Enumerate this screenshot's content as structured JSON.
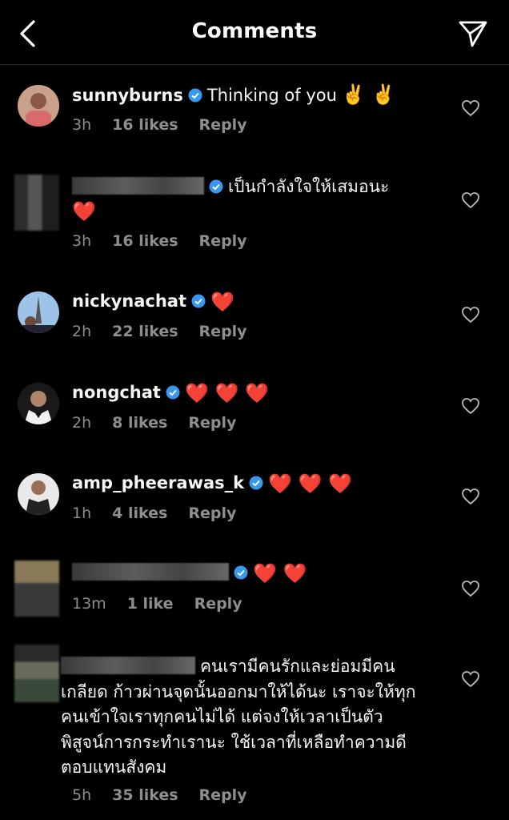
{
  "header": {
    "title": "Comments",
    "back_icon": "chevron-left-icon",
    "send_icon": "paper-plane-icon"
  },
  "colors": {
    "background": "#000000",
    "text": "#f5f5f5",
    "muted": "#8e8e8e",
    "verified": "#3897f0",
    "heart": "#ed2f3b"
  },
  "comments": [
    {
      "username": "sunnyburns",
      "text": "Thinking of you",
      "emoji": "✌️ ✌️",
      "time": "3h",
      "likes": "16 likes",
      "reply": "Reply"
    },
    {
      "username": "",
      "text": "เป็นกำลังใจให้เสมอนะ",
      "emoji": "❤️",
      "time": "3h",
      "likes": "16 likes",
      "reply": "Reply"
    },
    {
      "username": "nickynachat",
      "text": "",
      "emoji": "❤️",
      "time": "2h",
      "likes": "22 likes",
      "reply": "Reply"
    },
    {
      "username": "nongchat",
      "text": "",
      "emoji": "❤️ ❤️ ❤️",
      "time": "2h",
      "likes": "8 likes",
      "reply": "Reply"
    },
    {
      "username": "amp_pheerawas_k",
      "text": "",
      "emoji": "❤️ ❤️ ❤️",
      "time": "1h",
      "likes": "4 likes",
      "reply": "Reply"
    },
    {
      "username": "",
      "text": "",
      "emoji": "❤️ ❤️",
      "time": "13m",
      "likes": "1 like",
      "reply": "Reply"
    },
    {
      "username": "",
      "text": "คนเรามีคนรักและย่อมมีคน เกลียด ก้าวผ่านจุดนั้นออกมาให้ได้นะ เราจะให้ทุกคนเข้าใจเราทุกคนไม่ได้ แต่จงให้เวลาเป็นตัวพิสูจน์การกระทำเรานะ ใช้เวลาที่เหลือทำความดีตอบแทนสังคม",
      "emoji": "",
      "time": "5h",
      "likes": "35 likes",
      "reply": "Reply"
    }
  ]
}
